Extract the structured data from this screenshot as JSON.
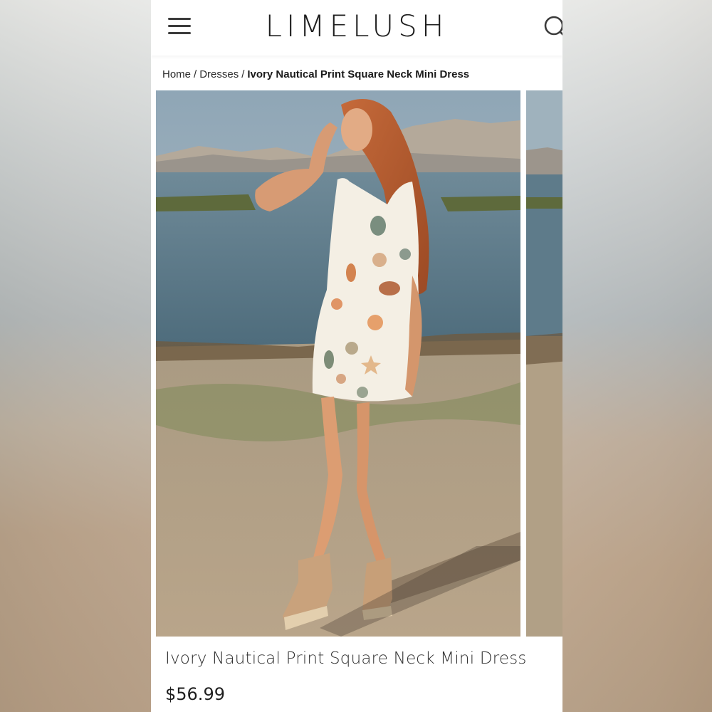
{
  "brand": {
    "logo_text": "LIMELUSH"
  },
  "header": {
    "menu_icon": "hamburger-menu-icon",
    "search_icon": "search-icon"
  },
  "breadcrumb": {
    "items": [
      "Home",
      "Dresses"
    ],
    "separator": "/",
    "current": "Ivory Nautical Print Square Neck Mini Dress"
  },
  "gallery": {
    "main_image": "photo-model-in-ivory-seashell-print-dress-at-lakeshore",
    "next_image": "photo-partial-next-slide"
  },
  "product": {
    "title": "Ivory Nautical Print Square Neck Mini Dress",
    "price": "$56.99"
  },
  "colors": {
    "text": "#1f1f1f",
    "background": "#ffffff",
    "page_backdrop": "#e6e6e4"
  }
}
